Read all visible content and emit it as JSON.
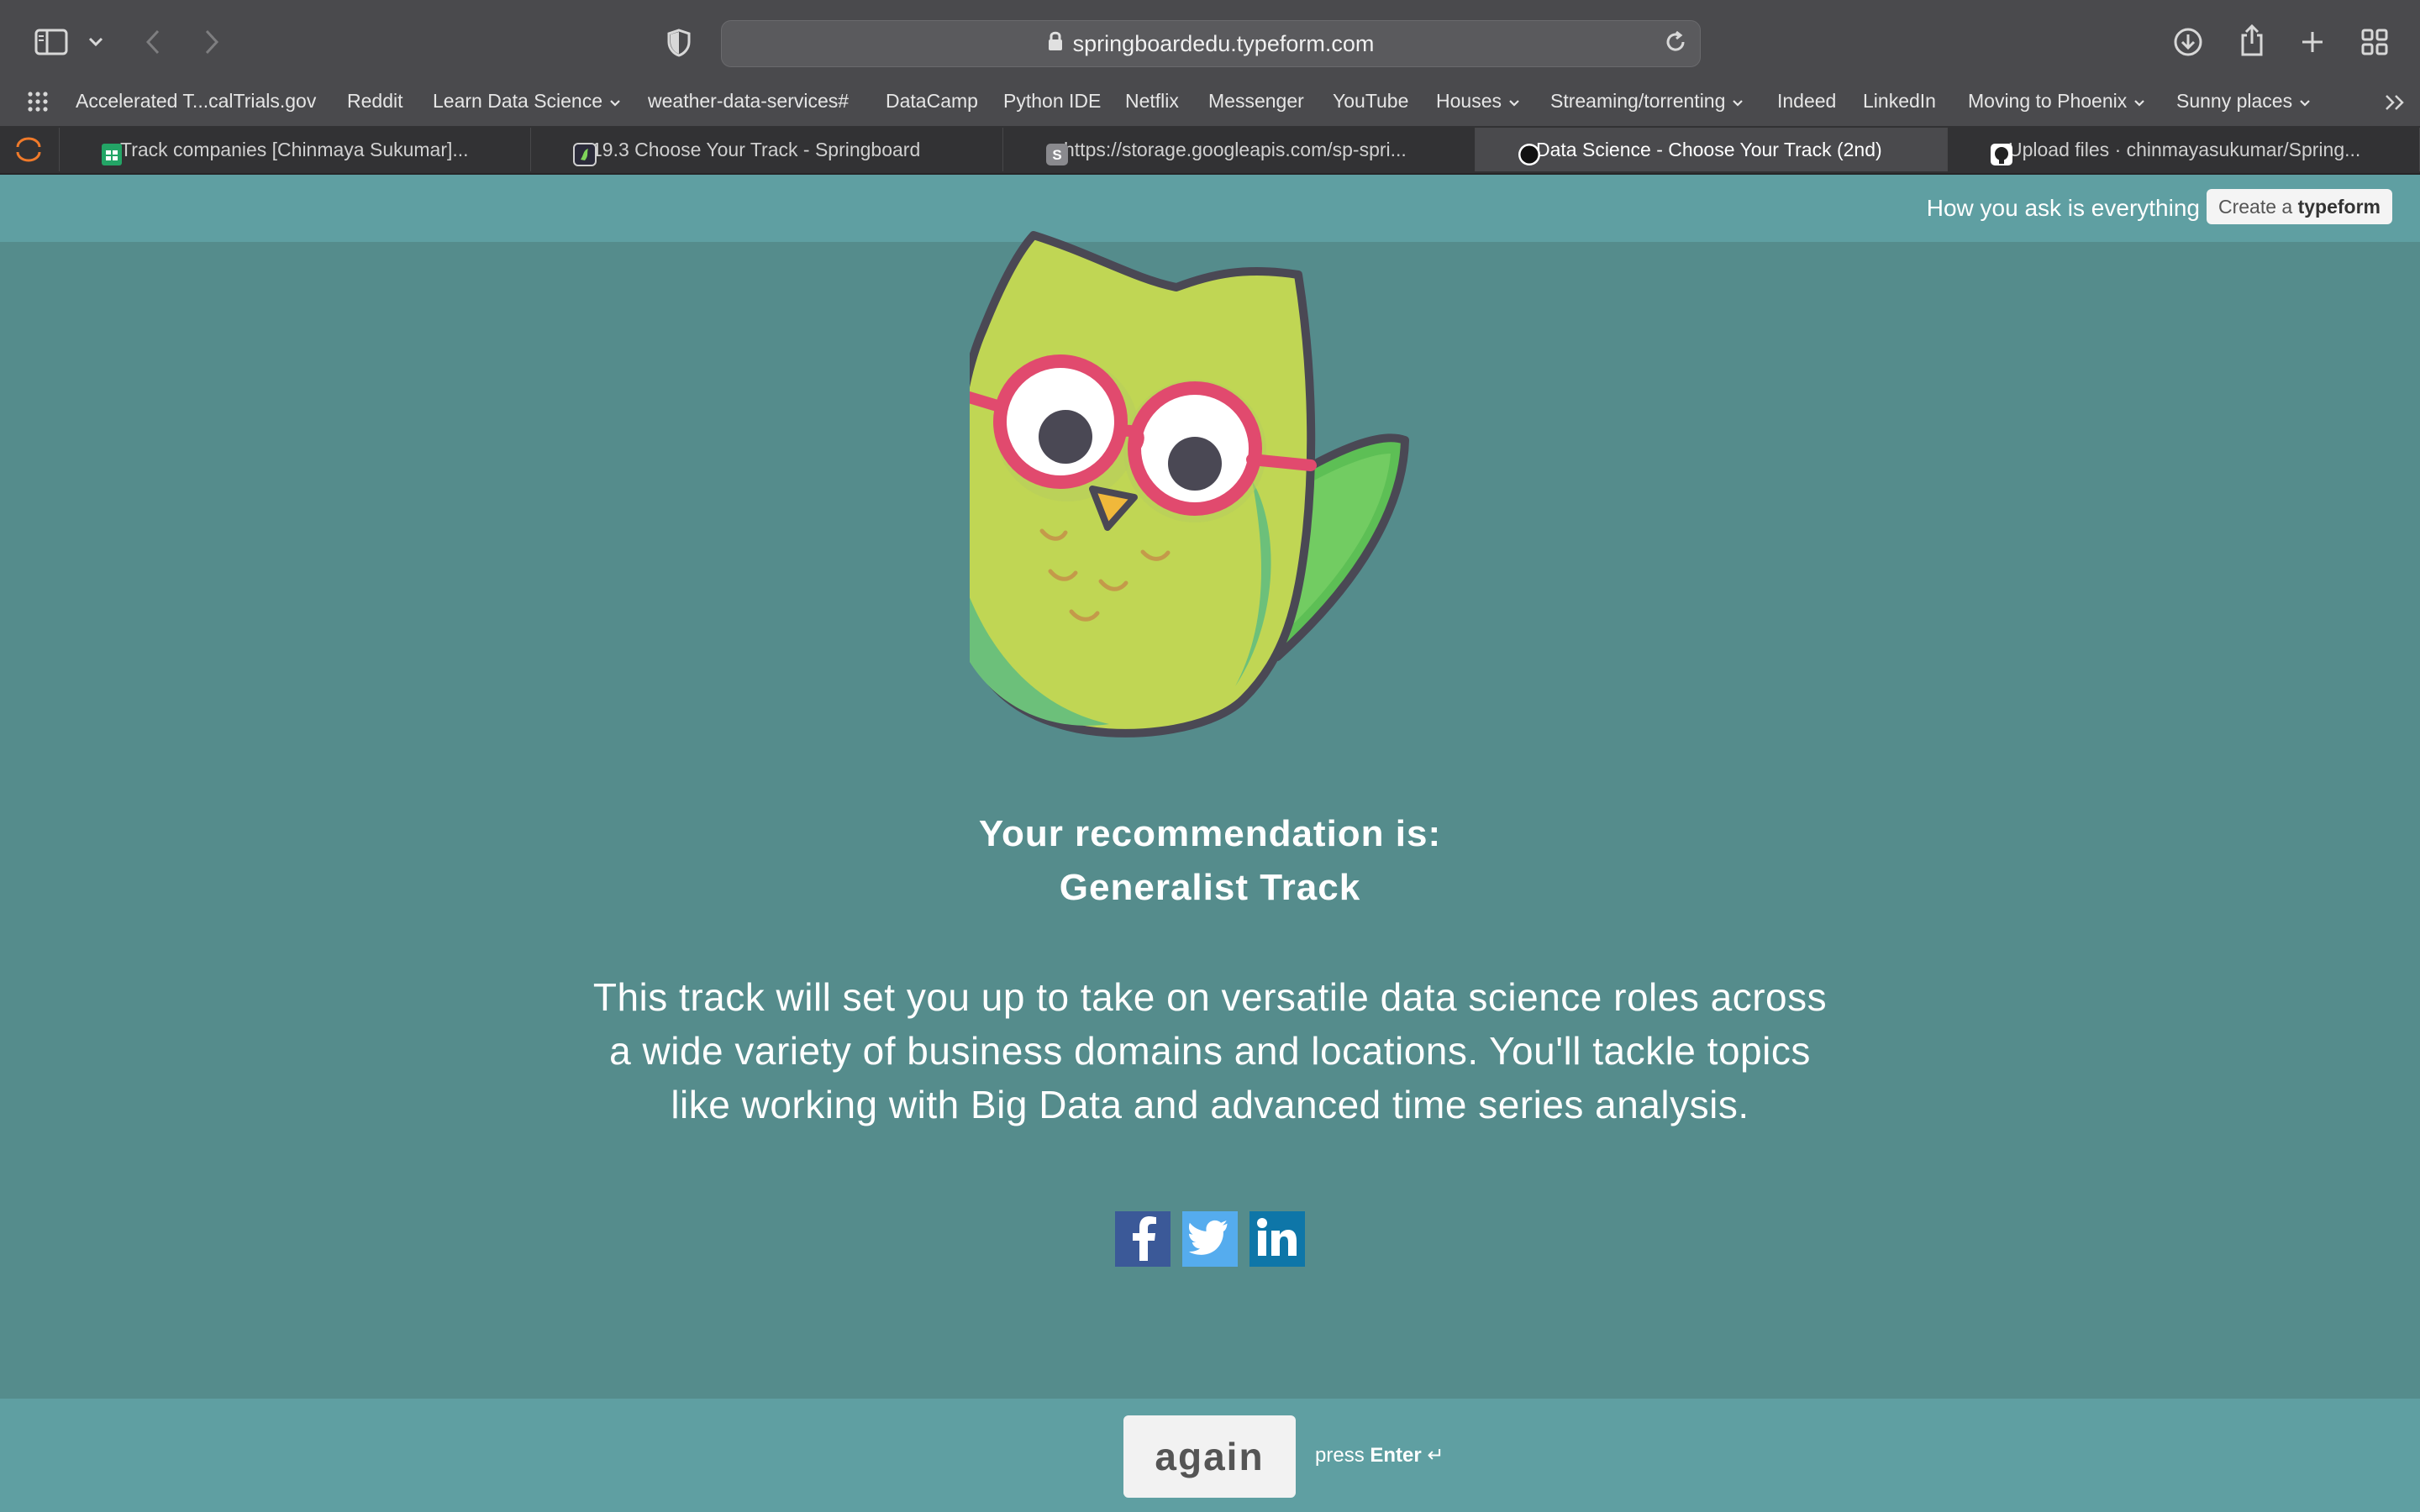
{
  "browser": {
    "url": "springboardedu.typeform.com",
    "bookmarks": [
      {
        "label": "Accelerated T...calTrials.gov",
        "dropdown": false
      },
      {
        "label": "Reddit",
        "dropdown": false
      },
      {
        "label": "Learn Data Science",
        "dropdown": true
      },
      {
        "label": "weather-data-services#",
        "dropdown": false
      },
      {
        "label": "DataCamp",
        "dropdown": false
      },
      {
        "label": "Python IDE",
        "dropdown": false
      },
      {
        "label": "Netflix",
        "dropdown": false
      },
      {
        "label": "Messenger",
        "dropdown": false
      },
      {
        "label": "YouTube",
        "dropdown": false
      },
      {
        "label": "Houses",
        "dropdown": true
      },
      {
        "label": "Streaming/torrenting",
        "dropdown": true
      },
      {
        "label": "Indeed",
        "dropdown": false
      },
      {
        "label": "LinkedIn",
        "dropdown": false
      },
      {
        "label": "Moving to Phoenix",
        "dropdown": true
      },
      {
        "label": "Sunny places",
        "dropdown": true
      }
    ],
    "tabs": [
      {
        "title": "Track companies [Chinmaya Sukumar]...",
        "active": false,
        "favicon": "sheets-icon"
      },
      {
        "title": "19.3 Choose Your Track - Springboard",
        "active": false,
        "favicon": "springboard-icon"
      },
      {
        "title": "https://storage.googleapis.com/sp-spri...",
        "active": false,
        "favicon": "s-letter-icon"
      },
      {
        "title": "Data Science - Choose Your Track (2nd)",
        "active": true,
        "favicon": "typeform-icon"
      },
      {
        "title": "Upload files · chinmayasukumar/Spring...",
        "active": false,
        "favicon": "github-icon"
      }
    ]
  },
  "typeform_header": {
    "tagline": "How you ask is everything",
    "create_prefix": "Create a ",
    "create_brand": "typeform"
  },
  "result": {
    "line1": "Your recommendation is:",
    "line2": "Generalist Track",
    "description": "This track will set you up to take on versatile data science roles across a wide variety of business domains and locations. You'll tackle topics like working with Big Data and advanced time series analysis.",
    "share": [
      {
        "icon": "facebook-icon",
        "color": "#3b5998"
      },
      {
        "icon": "twitter-icon",
        "color": "#55acee"
      },
      {
        "icon": "linkedin-icon",
        "color": "#0e76a8"
      }
    ]
  },
  "footer": {
    "button_label": "again",
    "hint_prefix": "press ",
    "hint_key": "Enter",
    "hint_symbol": "↵"
  },
  "colors": {
    "page_bg": "#558c8c",
    "header_bg": "#5f9fa2",
    "chrome_bg": "#4a4a4d"
  }
}
